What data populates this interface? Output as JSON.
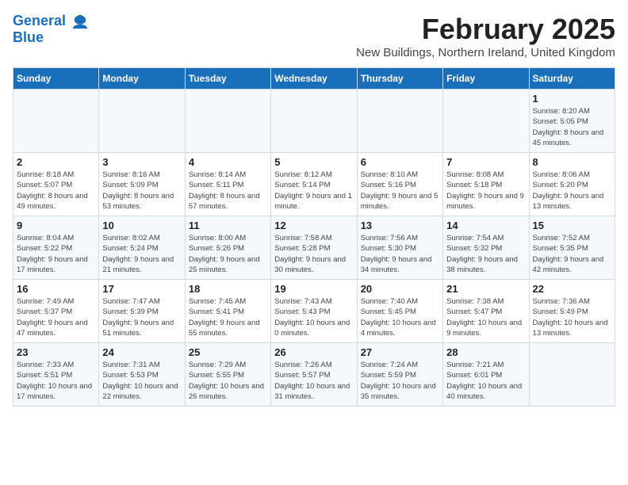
{
  "logo": {
    "line1": "General",
    "line2": "Blue"
  },
  "title": "February 2025",
  "subtitle": "New Buildings, Northern Ireland, United Kingdom",
  "days_of_week": [
    "Sunday",
    "Monday",
    "Tuesday",
    "Wednesday",
    "Thursday",
    "Friday",
    "Saturday"
  ],
  "weeks": [
    [
      {
        "day": "",
        "detail": ""
      },
      {
        "day": "",
        "detail": ""
      },
      {
        "day": "",
        "detail": ""
      },
      {
        "day": "",
        "detail": ""
      },
      {
        "day": "",
        "detail": ""
      },
      {
        "day": "",
        "detail": ""
      },
      {
        "day": "1",
        "detail": "Sunrise: 8:20 AM\nSunset: 5:05 PM\nDaylight: 8 hours and 45 minutes."
      }
    ],
    [
      {
        "day": "2",
        "detail": "Sunrise: 8:18 AM\nSunset: 5:07 PM\nDaylight: 8 hours and 49 minutes."
      },
      {
        "day": "3",
        "detail": "Sunrise: 8:16 AM\nSunset: 5:09 PM\nDaylight: 8 hours and 53 minutes."
      },
      {
        "day": "4",
        "detail": "Sunrise: 8:14 AM\nSunset: 5:11 PM\nDaylight: 8 hours and 57 minutes."
      },
      {
        "day": "5",
        "detail": "Sunrise: 8:12 AM\nSunset: 5:14 PM\nDaylight: 9 hours and 1 minute."
      },
      {
        "day": "6",
        "detail": "Sunrise: 8:10 AM\nSunset: 5:16 PM\nDaylight: 9 hours and 5 minutes."
      },
      {
        "day": "7",
        "detail": "Sunrise: 8:08 AM\nSunset: 5:18 PM\nDaylight: 9 hours and 9 minutes."
      },
      {
        "day": "8",
        "detail": "Sunrise: 8:06 AM\nSunset: 5:20 PM\nDaylight: 9 hours and 13 minutes."
      }
    ],
    [
      {
        "day": "9",
        "detail": "Sunrise: 8:04 AM\nSunset: 5:22 PM\nDaylight: 9 hours and 17 minutes."
      },
      {
        "day": "10",
        "detail": "Sunrise: 8:02 AM\nSunset: 5:24 PM\nDaylight: 9 hours and 21 minutes."
      },
      {
        "day": "11",
        "detail": "Sunrise: 8:00 AM\nSunset: 5:26 PM\nDaylight: 9 hours and 25 minutes."
      },
      {
        "day": "12",
        "detail": "Sunrise: 7:58 AM\nSunset: 5:28 PM\nDaylight: 9 hours and 30 minutes."
      },
      {
        "day": "13",
        "detail": "Sunrise: 7:56 AM\nSunset: 5:30 PM\nDaylight: 9 hours and 34 minutes."
      },
      {
        "day": "14",
        "detail": "Sunrise: 7:54 AM\nSunset: 5:32 PM\nDaylight: 9 hours and 38 minutes."
      },
      {
        "day": "15",
        "detail": "Sunrise: 7:52 AM\nSunset: 5:35 PM\nDaylight: 9 hours and 42 minutes."
      }
    ],
    [
      {
        "day": "16",
        "detail": "Sunrise: 7:49 AM\nSunset: 5:37 PM\nDaylight: 9 hours and 47 minutes."
      },
      {
        "day": "17",
        "detail": "Sunrise: 7:47 AM\nSunset: 5:39 PM\nDaylight: 9 hours and 51 minutes."
      },
      {
        "day": "18",
        "detail": "Sunrise: 7:45 AM\nSunset: 5:41 PM\nDaylight: 9 hours and 55 minutes."
      },
      {
        "day": "19",
        "detail": "Sunrise: 7:43 AM\nSunset: 5:43 PM\nDaylight: 10 hours and 0 minutes."
      },
      {
        "day": "20",
        "detail": "Sunrise: 7:40 AM\nSunset: 5:45 PM\nDaylight: 10 hours and 4 minutes."
      },
      {
        "day": "21",
        "detail": "Sunrise: 7:38 AM\nSunset: 5:47 PM\nDaylight: 10 hours and 9 minutes."
      },
      {
        "day": "22",
        "detail": "Sunrise: 7:36 AM\nSunset: 5:49 PM\nDaylight: 10 hours and 13 minutes."
      }
    ],
    [
      {
        "day": "23",
        "detail": "Sunrise: 7:33 AM\nSunset: 5:51 PM\nDaylight: 10 hours and 17 minutes."
      },
      {
        "day": "24",
        "detail": "Sunrise: 7:31 AM\nSunset: 5:53 PM\nDaylight: 10 hours and 22 minutes."
      },
      {
        "day": "25",
        "detail": "Sunrise: 7:29 AM\nSunset: 5:55 PM\nDaylight: 10 hours and 26 minutes."
      },
      {
        "day": "26",
        "detail": "Sunrise: 7:26 AM\nSunset: 5:57 PM\nDaylight: 10 hours and 31 minutes."
      },
      {
        "day": "27",
        "detail": "Sunrise: 7:24 AM\nSunset: 5:59 PM\nDaylight: 10 hours and 35 minutes."
      },
      {
        "day": "28",
        "detail": "Sunrise: 7:21 AM\nSunset: 6:01 PM\nDaylight: 10 hours and 40 minutes."
      },
      {
        "day": "",
        "detail": ""
      }
    ]
  ]
}
